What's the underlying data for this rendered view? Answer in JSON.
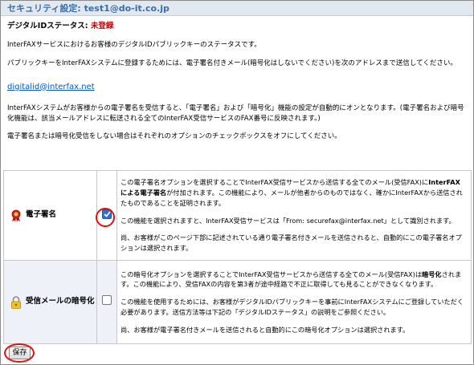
{
  "header": {
    "title": "セキュリティ設定: test1@do-it.co.jp"
  },
  "status": {
    "label": "デジタルIDステータス: ",
    "value": "未登録",
    "value_color": "#cc0000"
  },
  "intro": {
    "p1": "InterFAXサービスにおけるお客様のデジタルIDパブリックキーのステータスです。",
    "p2": "パブリックキーをInterFAXシステムに登録するためには、電子署名付きメール(暗号化はしないでください)を次のアドレスまで送信してください。",
    "email": "digitalid@interfax.net",
    "p3": "InterFAXシステムがお客様からの電子署名を受信すると、「電子署名」および「暗号化」機能の設定が自動的にオンとなります。(電子署名および暗号化機能は、該当メールアドレスに転送される全てのInterFAX受信サービスのFAX番号に反映されます。)",
    "p4": "電子署名または暗号化受信をしない場合はそれぞれのオプションのチェックボックスをオフにしてください。"
  },
  "options": [
    {
      "label": "電子署名",
      "icon": "award-ribbon-icon",
      "checked": true,
      "d1a": "この電子署名オプションを選択することでInterFAX受信サービスから送信する全てのメール(受信FAX)に",
      "d1b": "InterFAXによる電子署名",
      "d1c": "が付加されます。この機能により、メールが他者からのものではなく、確かにInterFAXから送信されたものであることを証明されます。",
      "d2": "この機能を選択されますと、InterFAX受信サービスは「From: securefax@interfax.net」として識別されます。",
      "d3": "尚、お客様がこのページ下部に記述されている通り電子署名付きメールを送信されると、自動的にこの電子署名オプションは選択されます。"
    },
    {
      "label": "受信メールの暗号化",
      "icon": "padlock-icon",
      "checked": false,
      "d1a": "この暗号化オプションを選択することでInterFAX受信サービスから送信する全てのメール(受信FAX)は",
      "d1b": "暗号化",
      "d1c": "されます。この機能により、受信FAXの内容を第3者が途中経路で不正に取得しても見ることができなくなります。",
      "d2": "この機能を使用するためには、お客様がデジタルIDパブリックキーを事前にInterFAXシステムにご登録していただく必要があります。送信方法等は下記の「デジタルIDステータス」の説明をご参照ください。",
      "d3": "尚、お客様が電子署名付きメールを送信されると自動的にこの暗号化オプションは選択されます。"
    }
  ],
  "footer": {
    "save_label": "保存"
  },
  "colors": {
    "title_text": "#3a6ea8",
    "highlight_circle": "#e01010",
    "link": "#0055cc"
  }
}
